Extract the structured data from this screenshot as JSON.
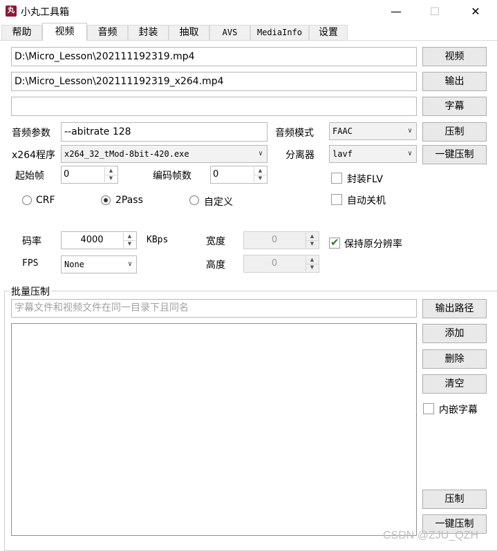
{
  "window": {
    "title": "小丸工具箱",
    "icon_text": "丸",
    "controls": {
      "minimize": "—",
      "maximize": "☐",
      "close": "✕"
    }
  },
  "tabs": [
    "帮助",
    "视频",
    "音频",
    "封装",
    "抽取",
    "AVS",
    "MediaInfo",
    "设置"
  ],
  "active_tab": "视频",
  "video": {
    "video_path": "D:\\Micro_Lesson\\202111192319.mp4",
    "output_path": "D:\\Micro_Lesson\\202111192319_x264.mp4",
    "subtitle_path": "",
    "buttons": {
      "video": "视频",
      "output": "输出",
      "subtitle": "字幕",
      "compress": "压制",
      "one_click": "一键压制"
    },
    "audio_params_label": "音频参数",
    "audio_params": "--abitrate 128",
    "audio_mode_label": "音频模式",
    "audio_mode": "FAAC",
    "x264_label": "x264程序",
    "x264_program": "x264_32_tMod-8bit-420.exe",
    "splitter_label": "分离器",
    "splitter": "lavf",
    "start_frame_label": "起始帧",
    "start_frame": "0",
    "frame_count_label": "编码帧数",
    "frame_count": "0",
    "flv_label": "封装FLV",
    "shutdown_label": "自动关机",
    "rate_modes": [
      "CRF",
      "2Pass",
      "自定义"
    ],
    "selected_rate_mode": "2Pass",
    "bitrate_label": "码率",
    "bitrate": "4000",
    "bitrate_unit": "KBps",
    "fps_label": "FPS",
    "fps": "None",
    "width_label": "宽度",
    "width": "0",
    "height_label": "高度",
    "height": "0",
    "keep_resolution_label": "保持原分辨率",
    "keep_resolution": true
  },
  "batch": {
    "title": "批量压制",
    "hint_placeholder": "字幕文件和视频文件在同一目录下且同名",
    "buttons": {
      "output_path": "输出路径",
      "add": "添加",
      "delete": "删除",
      "clear": "清空",
      "compress": "压制",
      "one_click": "一键压制"
    },
    "embed_subtitle_label": "内嵌字幕"
  },
  "watermark": "CSDN @ZJU_QZH"
}
